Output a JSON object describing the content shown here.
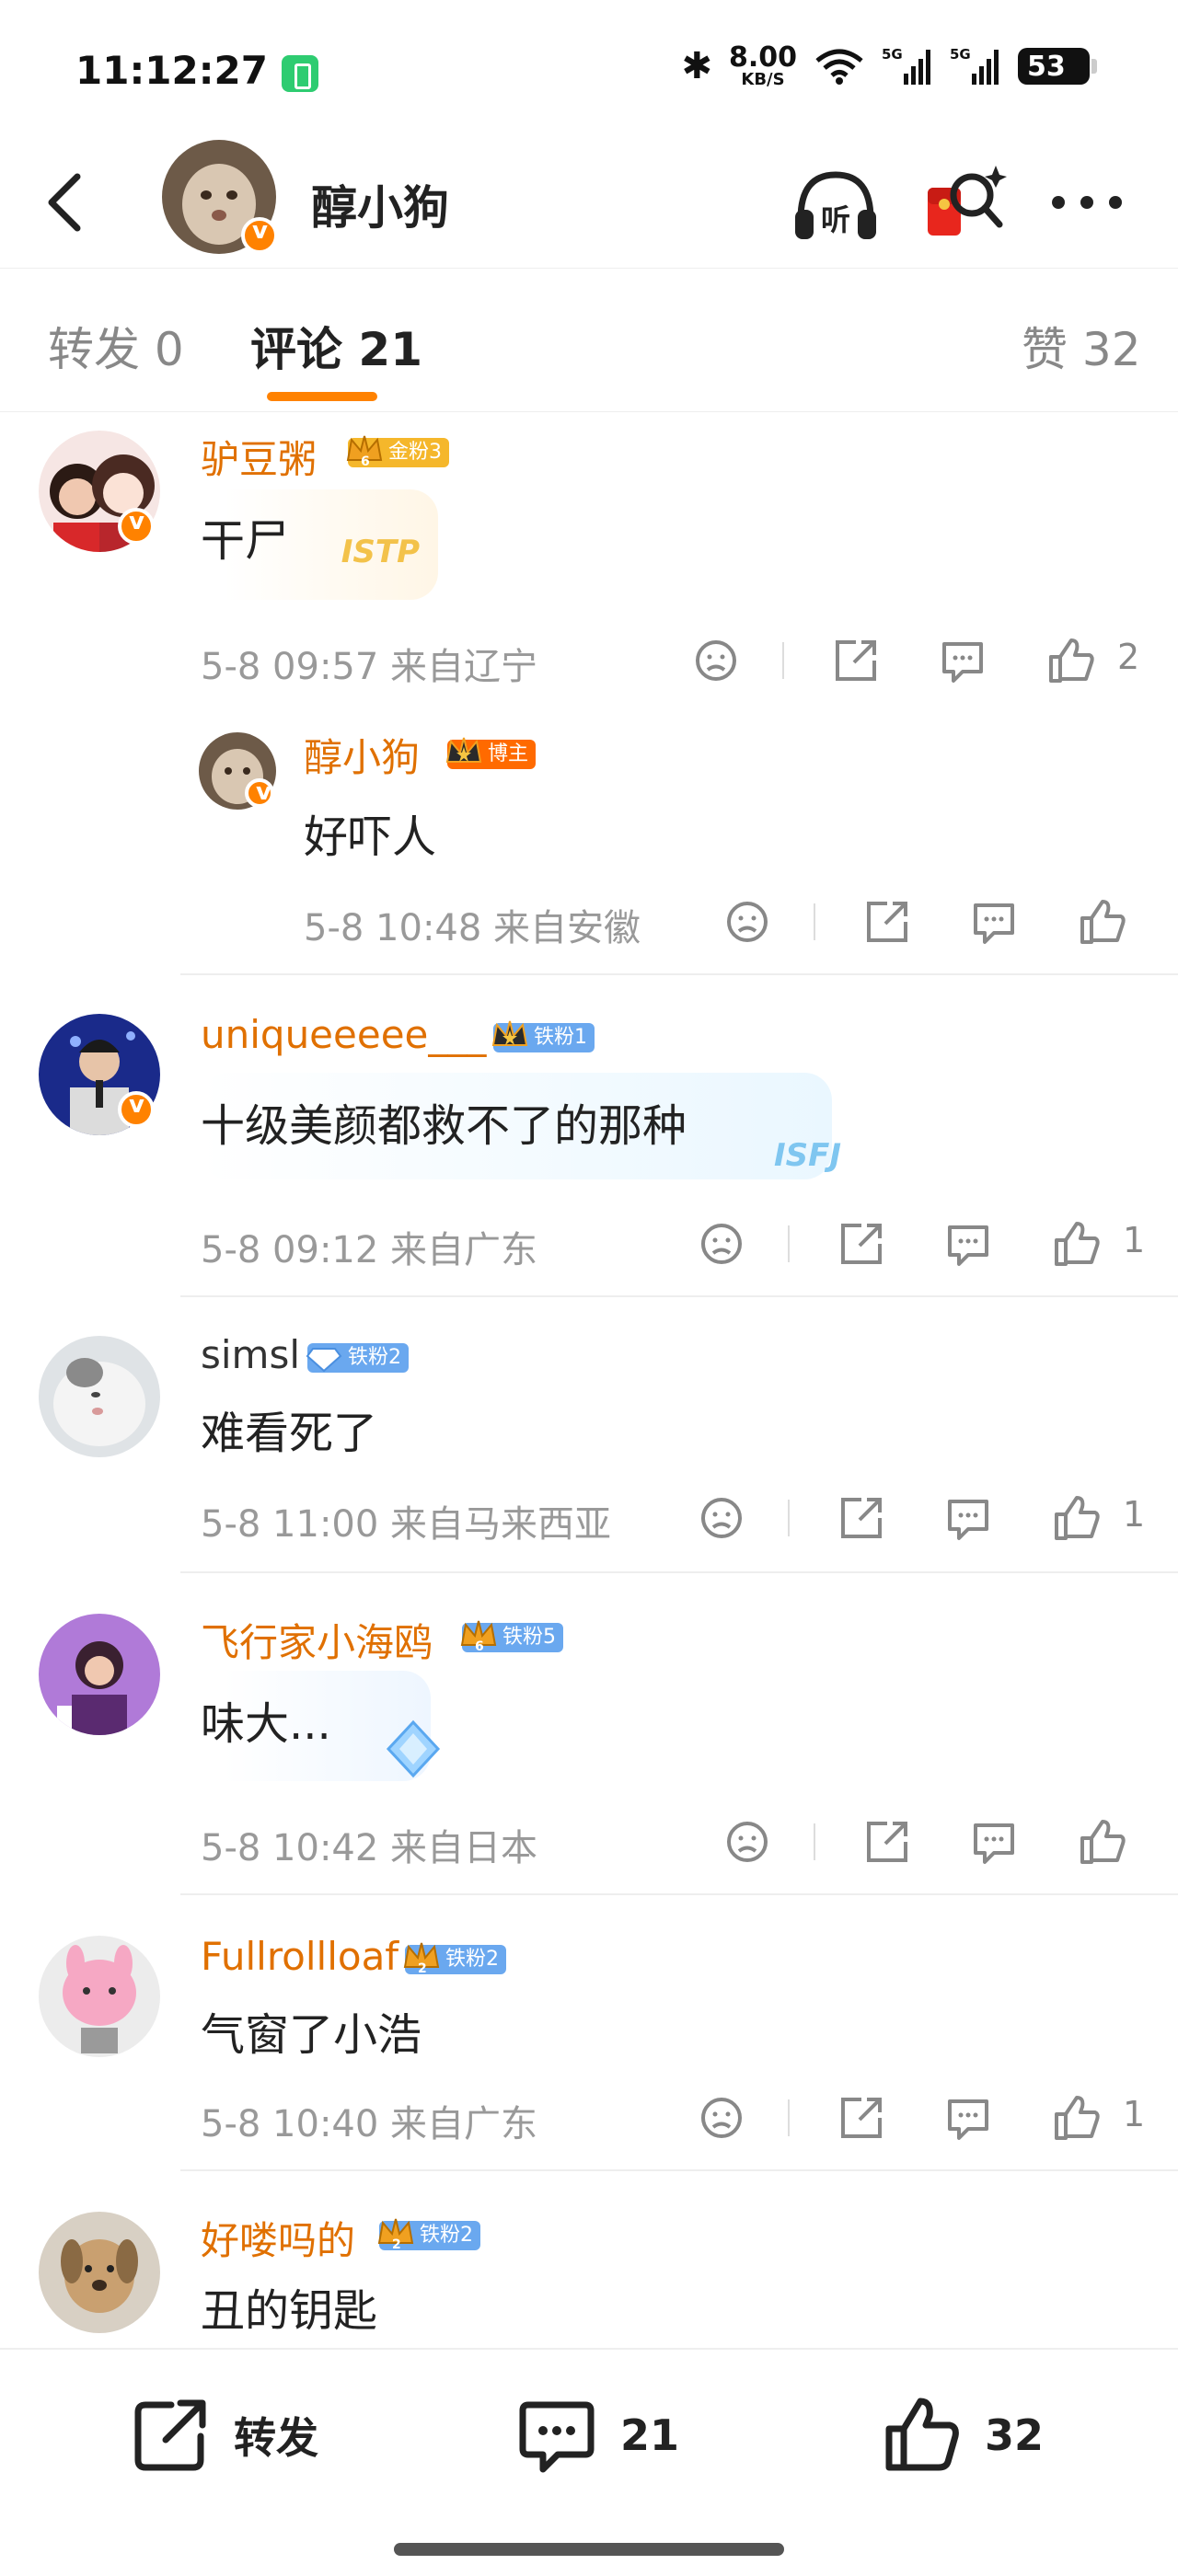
{
  "status_bar": {
    "time": "11:12:27",
    "network_speed": "8.00",
    "speed_unit": "KB/S",
    "signal_1": "5G",
    "signal_2": "5G",
    "battery": "53"
  },
  "header": {
    "title": "醇小狗",
    "icons": [
      "back-arrow-icon",
      "listen-icon",
      "red-packet-search-icon",
      "more-dots-icon"
    ],
    "listen_label": "听"
  },
  "tabs": {
    "repost": "转发 0",
    "comments": "评论 21",
    "likes": "赞 32",
    "active": "comments"
  },
  "comments": [
    {
      "username": "驴豆粥",
      "badge": "金粉3",
      "badge_level": "6",
      "text": "干尸",
      "card_tag": "ISTP",
      "time": "5-8 09:57",
      "location": "来自辽宁",
      "likes": "2",
      "reply": {
        "username": "醇小狗",
        "badge": "博主",
        "text": "好吓人",
        "time": "5-8 10:48",
        "location": "来自安徽"
      }
    },
    {
      "username": "uniqueeeee___",
      "badge": "铁粉1",
      "text": "十级美颜都救不了的那种",
      "card_tag": "ISFJ",
      "time": "5-8 09:12",
      "location": "来自广东",
      "likes": "1"
    },
    {
      "username": "simsl",
      "badge": "铁粉2",
      "text": "难看死了",
      "time": "5-8 11:00",
      "location": "来自马来西亚",
      "likes": "1"
    },
    {
      "username": "飞行家小海鸥",
      "badge": "铁粉5",
      "badge_level": "6",
      "text": "味大...",
      "time": "5-8 10:42",
      "location": "来自日本",
      "likes": ""
    },
    {
      "username": "Fullrollloaf",
      "badge": "铁粉2",
      "badge_level": "2",
      "text": "气窗了小浩",
      "time": "5-8 10:40",
      "location": "来自广东",
      "likes": "1"
    },
    {
      "username": "好喽吗的",
      "badge": "铁粉2",
      "badge_level": "2",
      "text": "丑的钥匙"
    }
  ],
  "bottom_bar": {
    "repost_label": "转发",
    "comment_count": "21",
    "like_count": "32"
  },
  "colors": {
    "accent": "#ff8200",
    "username": "#e07000",
    "meta": "#999999",
    "gold_badge": "#f5b72b",
    "iron_badge": "#6aa8ef"
  }
}
